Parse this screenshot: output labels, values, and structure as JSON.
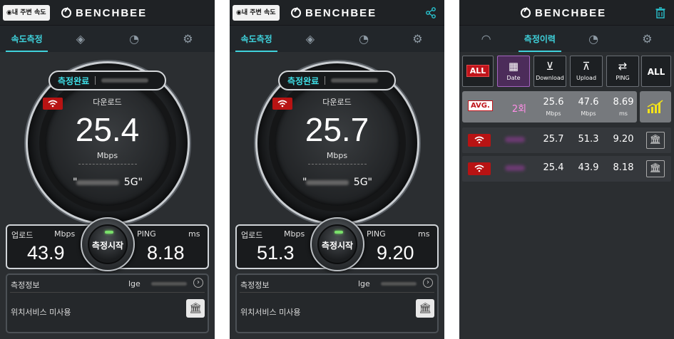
{
  "app": {
    "logo_text": "BENCHBEE",
    "near_speed_label": "◉내 주변 속도"
  },
  "tabs": {
    "speed": "속도측정",
    "history": "측정이력"
  },
  "screens": [
    {
      "status": "측정완료",
      "download_label": "다운로드",
      "download_value": "25.4",
      "download_unit": "Mbps",
      "network_suffix": "5G\"",
      "network_prefix": "\"",
      "upload_label": "업로드",
      "upload_unit": "Mbps",
      "upload_value": "43.9",
      "ping_label": "PING",
      "ping_unit": "ms",
      "ping_value": "8.18",
      "start_label": "측정시작",
      "info_title": "측정정보",
      "info_carrier": "lge",
      "location_text": "위치서비스 미사용"
    },
    {
      "status": "측정완료",
      "download_label": "다운로드",
      "download_value": "25.7",
      "download_unit": "Mbps",
      "network_suffix": "5G\"",
      "network_prefix": "\"",
      "upload_label": "업로드",
      "upload_unit": "Mbps",
      "upload_value": "51.3",
      "ping_label": "PING",
      "ping_unit": "ms",
      "ping_value": "9.20",
      "start_label": "측정시작",
      "info_title": "측정정보",
      "info_carrier": "lge",
      "location_text": "위치서비스 미사용"
    }
  ],
  "history": {
    "filters": {
      "all_left": "ALL",
      "date": "Date",
      "download": "Download",
      "upload": "Upload",
      "ping": "PING",
      "all_right": "ALL"
    },
    "avg": {
      "badge": "AVG.",
      "count": "2회",
      "download": "25.6",
      "upload": "47.6",
      "ping": "8.69",
      "dl_unit": "Mbps",
      "ul_unit": "Mbps",
      "ping_unit": "ms"
    },
    "rows": [
      {
        "download": "25.7",
        "upload": "51.3",
        "ping": "9.20"
      },
      {
        "download": "25.4",
        "upload": "43.9",
        "ping": "8.18"
      }
    ]
  }
}
